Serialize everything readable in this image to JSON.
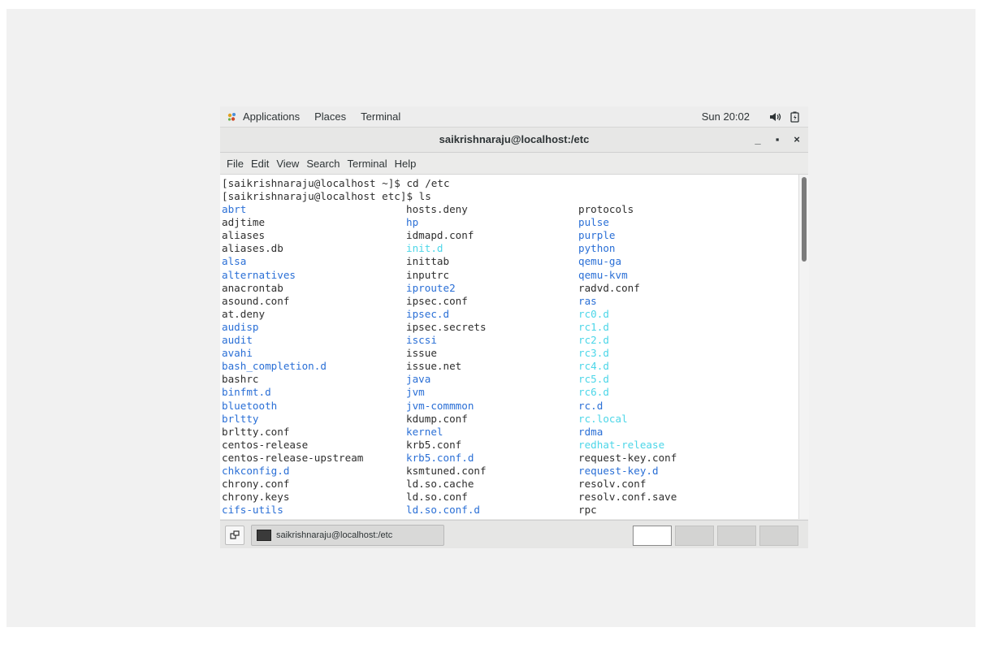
{
  "topbar": {
    "applications": "Applications",
    "places": "Places",
    "terminal": "Terminal",
    "clock": "Sun 20:02",
    "icons": [
      "applications-icon",
      "volume-icon",
      "battery-icon"
    ]
  },
  "window": {
    "title": "saikrishnaraju@localhost:/etc",
    "minimize": "_",
    "maximize": "▪",
    "close": "×"
  },
  "menubar": [
    "File",
    "Edit",
    "View",
    "Search",
    "Terminal",
    "Help"
  ],
  "terminal": {
    "prompt_lines": [
      "[saikrishnaraju@localhost ~]$ cd /etc",
      "[saikrishnaraju@localhost etc]$ ls"
    ],
    "colors": {
      "file": "#2e2e2e",
      "dir": "#2a6fd6",
      "link": "#4cd6e8"
    },
    "columns": [
      [
        {
          "name": "abrt",
          "type": "dir"
        },
        {
          "name": "adjtime",
          "type": "file"
        },
        {
          "name": "aliases",
          "type": "file"
        },
        {
          "name": "aliases.db",
          "type": "file"
        },
        {
          "name": "alsa",
          "type": "dir"
        },
        {
          "name": "alternatives",
          "type": "dir"
        },
        {
          "name": "anacrontab",
          "type": "file"
        },
        {
          "name": "asound.conf",
          "type": "file"
        },
        {
          "name": "at.deny",
          "type": "file"
        },
        {
          "name": "audisp",
          "type": "dir"
        },
        {
          "name": "audit",
          "type": "dir"
        },
        {
          "name": "avahi",
          "type": "dir"
        },
        {
          "name": "bash_completion.d",
          "type": "dir"
        },
        {
          "name": "bashrc",
          "type": "file"
        },
        {
          "name": "binfmt.d",
          "type": "dir"
        },
        {
          "name": "bluetooth",
          "type": "dir"
        },
        {
          "name": "brltty",
          "type": "dir"
        },
        {
          "name": "brltty.conf",
          "type": "file"
        },
        {
          "name": "centos-release",
          "type": "file"
        },
        {
          "name": "centos-release-upstream",
          "type": "file"
        },
        {
          "name": "chkconfig.d",
          "type": "dir"
        },
        {
          "name": "chrony.conf",
          "type": "file"
        },
        {
          "name": "chrony.keys",
          "type": "file"
        },
        {
          "name": "cifs-utils",
          "type": "dir"
        }
      ],
      [
        {
          "name": "hosts.deny",
          "type": "file"
        },
        {
          "name": "hp",
          "type": "dir"
        },
        {
          "name": "idmapd.conf",
          "type": "file"
        },
        {
          "name": "init.d",
          "type": "link"
        },
        {
          "name": "inittab",
          "type": "file"
        },
        {
          "name": "inputrc",
          "type": "file"
        },
        {
          "name": "iproute2",
          "type": "dir"
        },
        {
          "name": "ipsec.conf",
          "type": "file"
        },
        {
          "name": "ipsec.d",
          "type": "dir"
        },
        {
          "name": "ipsec.secrets",
          "type": "file"
        },
        {
          "name": "iscsi",
          "type": "dir"
        },
        {
          "name": "issue",
          "type": "file"
        },
        {
          "name": "issue.net",
          "type": "file"
        },
        {
          "name": "java",
          "type": "dir"
        },
        {
          "name": "jvm",
          "type": "dir"
        },
        {
          "name": "jvm-commmon",
          "type": "dir"
        },
        {
          "name": "kdump.conf",
          "type": "file"
        },
        {
          "name": "kernel",
          "type": "dir"
        },
        {
          "name": "krb5.conf",
          "type": "file"
        },
        {
          "name": "krb5.conf.d",
          "type": "dir"
        },
        {
          "name": "ksmtuned.conf",
          "type": "file"
        },
        {
          "name": "ld.so.cache",
          "type": "file"
        },
        {
          "name": "ld.so.conf",
          "type": "file"
        },
        {
          "name": "ld.so.conf.d",
          "type": "dir"
        }
      ],
      [
        {
          "name": "protocols",
          "type": "file"
        },
        {
          "name": "pulse",
          "type": "dir"
        },
        {
          "name": "purple",
          "type": "dir"
        },
        {
          "name": "python",
          "type": "dir"
        },
        {
          "name": "qemu-ga",
          "type": "dir"
        },
        {
          "name": "qemu-kvm",
          "type": "dir"
        },
        {
          "name": "radvd.conf",
          "type": "file"
        },
        {
          "name": "ras",
          "type": "dir"
        },
        {
          "name": "rc0.d",
          "type": "link"
        },
        {
          "name": "rc1.d",
          "type": "link"
        },
        {
          "name": "rc2.d",
          "type": "link"
        },
        {
          "name": "rc3.d",
          "type": "link"
        },
        {
          "name": "rc4.d",
          "type": "link"
        },
        {
          "name": "rc5.d",
          "type": "link"
        },
        {
          "name": "rc6.d",
          "type": "link"
        },
        {
          "name": "rc.d",
          "type": "dir"
        },
        {
          "name": "rc.local",
          "type": "link"
        },
        {
          "name": "rdma",
          "type": "dir"
        },
        {
          "name": "redhat-release",
          "type": "link"
        },
        {
          "name": "request-key.conf",
          "type": "file"
        },
        {
          "name": "request-key.d",
          "type": "dir"
        },
        {
          "name": "resolv.conf",
          "type": "file"
        },
        {
          "name": "resolv.conf.save",
          "type": "file"
        },
        {
          "name": "rpc",
          "type": "file"
        }
      ]
    ]
  },
  "taskbar": {
    "task_label": "saikrishnaraju@localhost:/etc",
    "workspaces": 4,
    "active_workspace": 1
  }
}
